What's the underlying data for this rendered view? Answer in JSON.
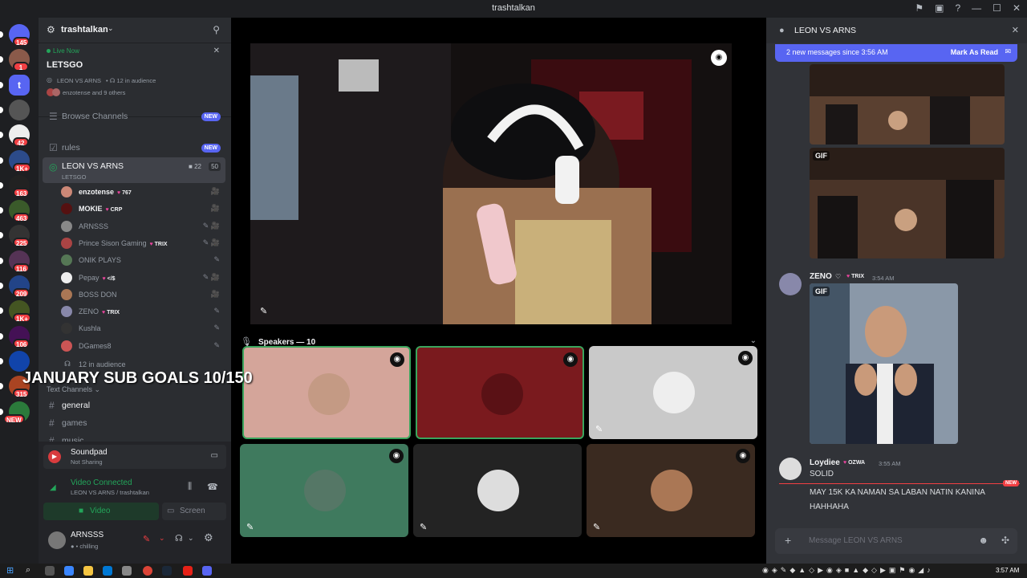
{
  "window": {
    "title": "trashtalkan"
  },
  "guilds": [
    {
      "badge": "145",
      "color": "#5865f2"
    },
    {
      "badge": "1",
      "color": "#8a5a4a"
    },
    {
      "badge": "",
      "color": "#5865f2",
      "letter": "t"
    },
    {
      "badge": "",
      "color": "#555"
    },
    {
      "badge": "42",
      "color": "#eee"
    },
    {
      "badge": "1K+",
      "color": "#2c4b8a"
    },
    {
      "badge": "163",
      "color": "#222"
    },
    {
      "badge": "463",
      "color": "#3a5a2a"
    },
    {
      "badge": "225",
      "color": "#333"
    },
    {
      "badge": "116",
      "color": "#553355"
    },
    {
      "badge": "209",
      "color": "#224488"
    },
    {
      "badge": "1K+",
      "color": "#445522"
    },
    {
      "badge": "106",
      "color": "#441155"
    },
    {
      "badge": "",
      "color": "#1144aa"
    },
    {
      "badge": "315",
      "color": "#aa4422"
    },
    {
      "badge": "NEW",
      "color": "#2b7a3b"
    }
  ],
  "server": {
    "name": "trashtalkan"
  },
  "live": {
    "status": "Live Now",
    "title": "LETSGO",
    "channel_info": "LEON VS ARNS",
    "audience": "12 in audience",
    "viewers": "enzotense and 9 others"
  },
  "channels": {
    "browse": "Browse Channels",
    "browse_badge": "NEW",
    "rules": "rules",
    "rules_badge": "NEW",
    "voice": {
      "name": "LEON VS ARNS",
      "sub": "LETSGO",
      "video_count": "22",
      "limit": "50"
    },
    "users": [
      {
        "name": "enzotense",
        "tag": "767",
        "color": "#f2f3f5",
        "av": "#cc8877"
      },
      {
        "name": "MOKIE",
        "tag": "CRP",
        "color": "#f2f3f5",
        "av": "#551111"
      },
      {
        "name": "ARNSSS",
        "tag": "",
        "color": "#949ba4",
        "av": "#888"
      },
      {
        "name": "Prince Sison Gaming",
        "tag": "TRIX",
        "color": "#949ba4",
        "av": "#aa4444"
      },
      {
        "name": "ONIK PLAYS",
        "tag": "",
        "color": "#949ba4",
        "av": "#557755"
      },
      {
        "name": "Pepay",
        "tag": "</$",
        "color": "#949ba4",
        "av": "#eee"
      },
      {
        "name": "BOSS DON",
        "tag": "",
        "color": "#949ba4",
        "av": "#aa7755"
      },
      {
        "name": "ZENO",
        "tag": "TRIX",
        "color": "#949ba4",
        "av": "#8888aa"
      },
      {
        "name": "Kushla",
        "tag": "",
        "color": "#949ba4",
        "av": "#333"
      },
      {
        "name": "DGames8",
        "tag": "",
        "color": "#949ba4",
        "av": "#cc5555"
      }
    ],
    "audience": "12 in audience",
    "text_header": "Text Channels",
    "general": "general",
    "games": "games",
    "music": "music"
  },
  "overlay_text": "JANUARY SUB GOALS 10/150",
  "soundpad": {
    "name": "Soundpad",
    "status": "Not Sharing"
  },
  "voice_conn": {
    "status": "Video Connected",
    "detail": "LEON VS ARNS / trashtalkan",
    "video": "Video",
    "screen": "Screen"
  },
  "me": {
    "name": "ARNSSS",
    "status": "chilling"
  },
  "stage": {
    "speakers": "Speakers — 10"
  },
  "tiles": [
    {
      "bg": "#d4a59a",
      "av": "#c49a84",
      "border": "#3ba55d"
    },
    {
      "bg": "#7a1a1e",
      "av": "#5a1115",
      "border": "#3ba55d"
    },
    {
      "bg": "#c9c9c9",
      "av": "#eee",
      "border": ""
    },
    {
      "bg": "#3f7a5e",
      "av": "#557766",
      "border": ""
    },
    {
      "bg": "#232323",
      "av": "#ddd",
      "border": ""
    },
    {
      "bg": "#3a2a20",
      "av": "#aa7755",
      "border": ""
    }
  ],
  "chat": {
    "title": "LEON VS ARNS",
    "banner": "2 new messages since 3:56 AM",
    "mark_read": "Mark As Read",
    "gif_label": "GIF",
    "messages": [
      {
        "author": "ZENO",
        "tag": "TRIX",
        "time": "3:54 AM"
      },
      {
        "author": "Loydiee",
        "tag": "OZWA",
        "time": "3:55 AM",
        "line1": "SOLID",
        "new": "NEW",
        "line2": "MAY 15K KA NAMAN SA LABAN NATIN KANINA",
        "line3": "HAHHAHA"
      }
    ],
    "placeholder": "Message LEON VS ARNS"
  },
  "taskbar": {
    "time": "3:57 AM"
  }
}
